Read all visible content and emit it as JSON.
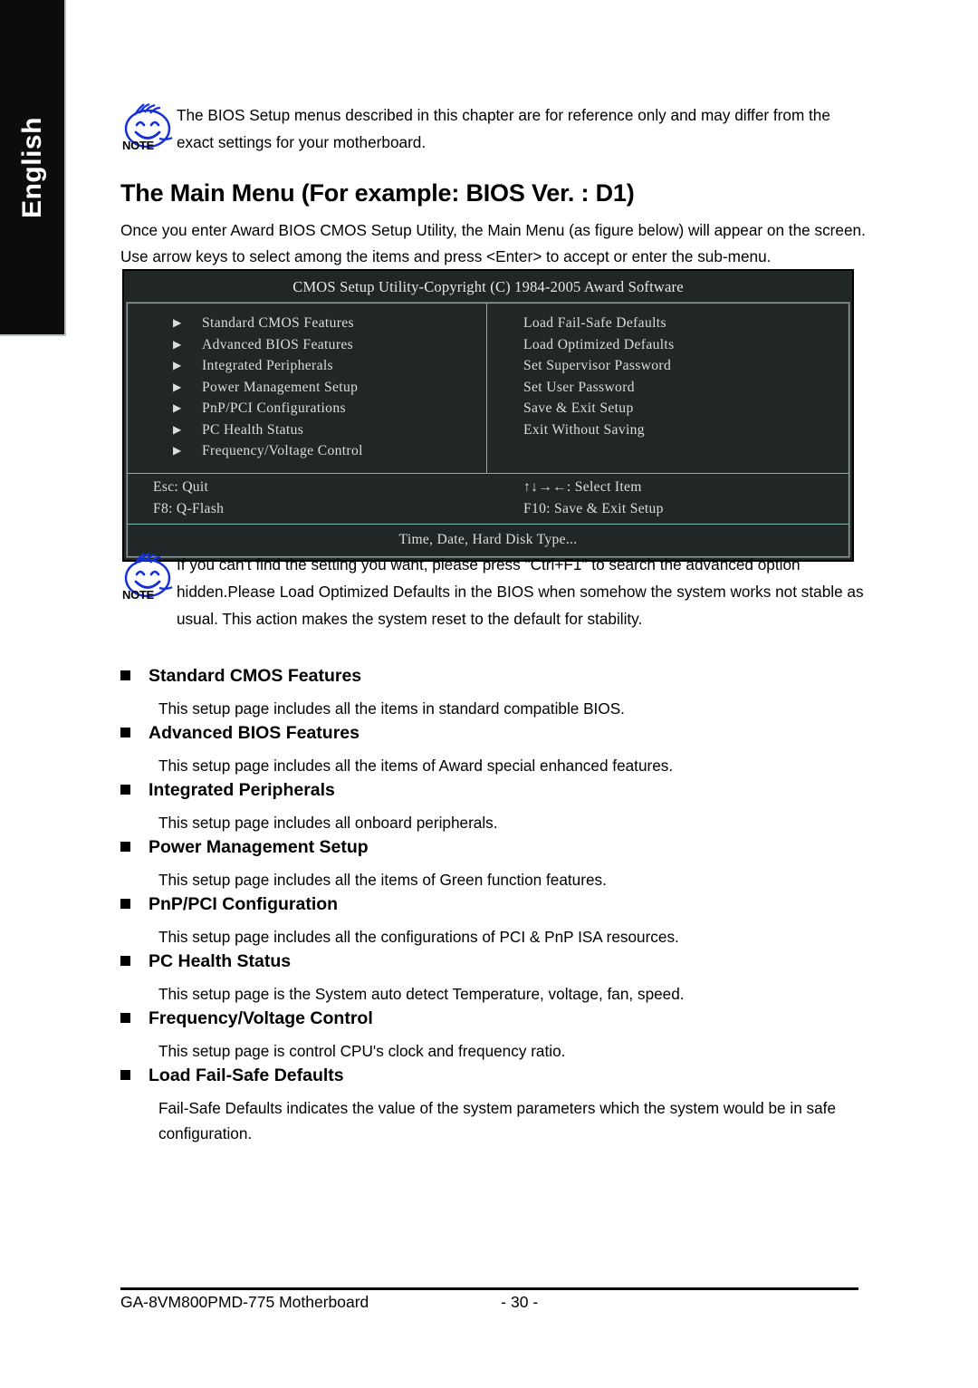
{
  "sidebar": {
    "language_label": "English"
  },
  "notes": {
    "top": {
      "icon": "note-smiley-icon",
      "badge": "NOTE",
      "text": "The BIOS Setup menus described in this chapter are for reference only and may differ from the exact settings for your motherboard."
    },
    "bottom": {
      "icon": "note-smiley-icon",
      "badge": "NOTE",
      "text": "If you can't find the setting you want, please press \"Ctrl+F1\" to search the advanced option hidden.Please Load Optimized Defaults in the BIOS when somehow the system works not stable as usual. This action makes the system reset to the default for stability."
    }
  },
  "section": {
    "title": "The Main Menu (For example: BIOS Ver. : D1)",
    "intro": "Once you enter Award BIOS CMOS Setup Utility, the Main Menu (as figure below) will appear on the screen.  Use arrow keys to select among the items and press <Enter> to accept or enter the sub-menu."
  },
  "bios_screen": {
    "title": "CMOS Setup Utility-Copyright (C) 1984-2005 Award Software",
    "left_items": [
      "Standard CMOS Features",
      "Advanced BIOS Features",
      "Integrated Peripherals",
      "Power  Management  Setup",
      "PnP/PCI Configurations",
      "PC Health Status",
      "Frequency/Voltage Control"
    ],
    "right_items": [
      "Load Fail-Safe Defaults",
      "Load Optimized Defaults",
      "Set Supervisor Password",
      "Set User Password",
      "Save & Exit Setup",
      "Exit Without Saving"
    ],
    "keys_left": [
      "Esc: Quit",
      "F8: Q-Flash"
    ],
    "keys_right": [
      "↑↓→←: Select Item",
      "F10: Save & Exit Setup"
    ],
    "status_bar": "Time, Date, Hard Disk Type...",
    "arrow_glyph": "▶",
    "colors": {
      "background": "#212727",
      "text": "#d8dede",
      "border": "#9aa4a4",
      "accent_rule": "#7fb3aa"
    }
  },
  "items": [
    {
      "heading": "Standard CMOS Features",
      "body": "This setup page includes all the items in standard compatible BIOS."
    },
    {
      "heading": "Advanced BIOS Features",
      "body": "This setup page includes all the items of Award special enhanced features."
    },
    {
      "heading": "Integrated Peripherals",
      "body": "This setup page includes all onboard peripherals."
    },
    {
      "heading": "Power Management Setup",
      "body": "This setup page includes all the items of Green function features."
    },
    {
      "heading": "PnP/PCI Configuration",
      "body": "This setup page includes all the configurations of PCI & PnP ISA resources."
    },
    {
      "heading": "PC Health Status",
      "body": "This setup page is the System auto detect Temperature, voltage, fan, speed."
    },
    {
      "heading": "Frequency/Voltage Control",
      "body": "This setup page is control CPU's clock and frequency ratio."
    },
    {
      "heading": "Load Fail-Safe Defaults",
      "body": "Fail-Safe Defaults indicates the value of the system parameters which the system would be in safe configuration."
    }
  ],
  "footer": {
    "product": "GA-8VM800PMD-775 Motherboard",
    "page_number": "- 30 -"
  }
}
